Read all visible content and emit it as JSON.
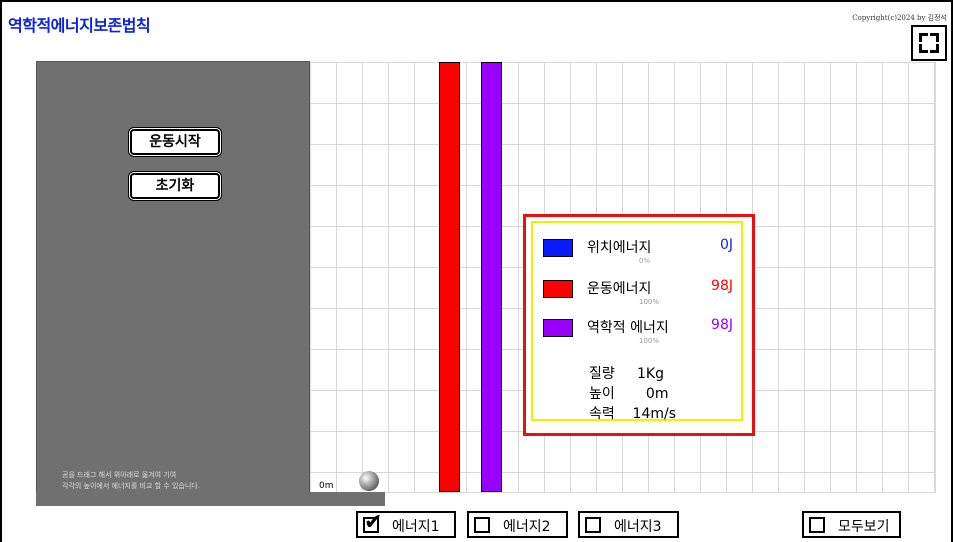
{
  "app": {
    "title": "역학적에너지보존법칙",
    "copyright": "Copyright(c)2024 by 김정석"
  },
  "controls": {
    "start_label": "운동시작",
    "reset_label": "초기화"
  },
  "stage": {
    "hint_line1": "공을 드래그 해서 위아래로 옮겨여 기여",
    "hint_line2": "각각의 높이에서 에너지를 비교 할 수 있습니다.",
    "height_label": "0m"
  },
  "bars": {
    "kinetic_fraction": 1.0,
    "mechanical_fraction": 1.0
  },
  "colors": {
    "potential": "#0a1aff",
    "kinetic": "#ff0000",
    "mechanical": "#9900ff"
  },
  "energy_panel": {
    "potential": {
      "label": "위치에너지",
      "value": "0J",
      "percent": "0%"
    },
    "kinetic": {
      "label": "운동에너지",
      "value": "98J",
      "percent": "100%"
    },
    "mechanical": {
      "label": "역학적 에너지",
      "value": "98J",
      "percent": "100%"
    },
    "mass": "질량     1Kg",
    "height": "높이       0m",
    "speed": "속력    14m/s"
  },
  "footer": {
    "energy1": {
      "label": "에너지1",
      "checked": true
    },
    "energy2": {
      "label": "에너지2",
      "checked": false
    },
    "energy3": {
      "label": "에너지3",
      "checked": false
    },
    "show_all": {
      "label": "모두보기",
      "checked": false
    }
  }
}
